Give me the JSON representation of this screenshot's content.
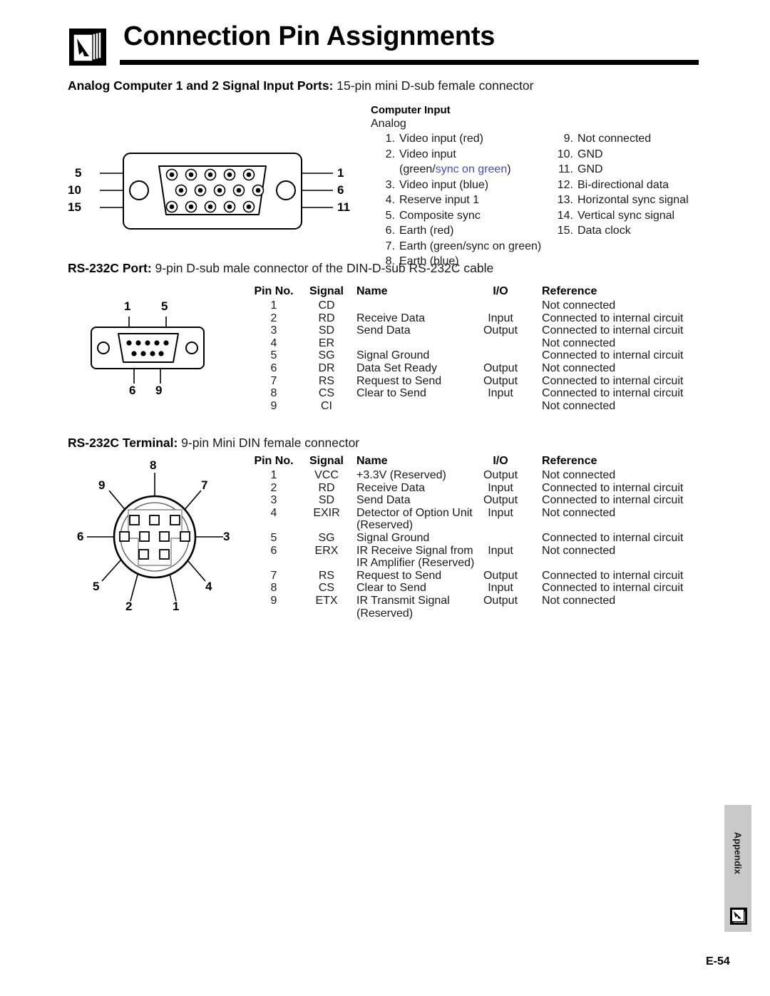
{
  "document": {
    "title": "Connection Pin Assignments",
    "page_number": "E-54",
    "tab_label": "Appendix"
  },
  "sections": {
    "analog": {
      "heading_bold": "Analog Computer 1 and 2 Signal Input Ports:",
      "heading_rest": " 15-pin mini D-sub female connector",
      "computer_input_title": "Computer Input",
      "analog_label": "Analog",
      "left_items": [
        {
          "num": "1.",
          "text": "Video input (red)"
        },
        {
          "num": "2.",
          "text": "Video input"
        },
        {
          "num": "3.",
          "text": "Video input (blue)"
        },
        {
          "num": "4.",
          "text": "Reserve input 1"
        },
        {
          "num": "5.",
          "text": "Composite sync"
        },
        {
          "num": "6.",
          "text": "Earth (red)"
        },
        {
          "num": "7.",
          "text": "Earth (green/sync on green)"
        },
        {
          "num": "8.",
          "text": "Earth (blue)"
        }
      ],
      "item2_sub_pre": "(green/",
      "item2_sub_blue": "sync on green",
      "item2_sub_post": ")",
      "right_items": [
        {
          "num": "9.",
          "text": "Not connected"
        },
        {
          "num": "10.",
          "text": "GND"
        },
        {
          "num": "11.",
          "text": "GND"
        },
        {
          "num": "12.",
          "text": "Bi-directional data"
        },
        {
          "num": "13.",
          "text": "Horizontal sync signal"
        },
        {
          "num": "14.",
          "text": "Vertical sync signal"
        },
        {
          "num": "15.",
          "text": "Data clock"
        }
      ],
      "diagram_labels": {
        "left": [
          "5",
          "10",
          "15"
        ],
        "right": [
          "1",
          "6",
          "11"
        ]
      }
    },
    "rs232c_port": {
      "heading_bold": "RS-232C Port:",
      "heading_rest": " 9-pin D-sub male connector of the DIN-D-sub RS-232C cable",
      "diagram_labels": {
        "top": [
          "1",
          "5"
        ],
        "bottom": [
          "6",
          "9"
        ]
      },
      "columns": [
        "Pin No.",
        "Signal",
        "Name",
        "I/O",
        "Reference"
      ],
      "rows": [
        {
          "pin": "1",
          "signal": "CD",
          "name": "",
          "io": "",
          "ref": "Not connected"
        },
        {
          "pin": "2",
          "signal": "RD",
          "name": "Receive Data",
          "io": "Input",
          "ref": "Connected to internal circuit"
        },
        {
          "pin": "3",
          "signal": "SD",
          "name": "Send Data",
          "io": "Output",
          "ref": "Connected to internal circuit"
        },
        {
          "pin": "4",
          "signal": "ER",
          "name": "",
          "io": "",
          "ref": "Not connected"
        },
        {
          "pin": "5",
          "signal": "SG",
          "name": "Signal Ground",
          "io": "",
          "ref": "Connected to internal circuit"
        },
        {
          "pin": "6",
          "signal": "DR",
          "name": "Data Set Ready",
          "io": "Output",
          "ref": "Not connected"
        },
        {
          "pin": "7",
          "signal": "RS",
          "name": "Request to Send",
          "io": "Output",
          "ref": "Connected to internal circuit"
        },
        {
          "pin": "8",
          "signal": "CS",
          "name": "Clear to Send",
          "io": "Input",
          "ref": "Connected to internal circuit"
        },
        {
          "pin": "9",
          "signal": "CI",
          "name": "",
          "io": "",
          "ref": "Not connected"
        }
      ]
    },
    "rs232c_terminal": {
      "heading_bold": "RS-232C Terminal:",
      "heading_rest": " 9-pin Mini DIN female connector",
      "diagram_labels": {
        "p1": "1",
        "p2": "2",
        "p3": "3",
        "p4": "4",
        "p5": "5",
        "p6": "6",
        "p7": "7",
        "p8": "8",
        "p9": "9"
      },
      "columns": [
        "Pin No.",
        "Signal",
        "Name",
        "I/O",
        "Reference"
      ],
      "rows": [
        {
          "pin": "1",
          "signal": "VCC",
          "name": "+3.3V (Reserved)",
          "name2": "",
          "io": "Output",
          "ref": "Not connected"
        },
        {
          "pin": "2",
          "signal": "RD",
          "name": "Receive Data",
          "name2": "",
          "io": "Input",
          "ref": "Connected to internal circuit"
        },
        {
          "pin": "3",
          "signal": "SD",
          "name": "Send Data",
          "name2": "",
          "io": "Output",
          "ref": "Connected to internal circuit"
        },
        {
          "pin": "4",
          "signal": "EXIR",
          "name": "Detector of Option Unit",
          "name2": "(Reserved)",
          "io": "Input",
          "ref": "Not connected"
        },
        {
          "pin": "5",
          "signal": "SG",
          "name": "Signal Ground",
          "name2": "",
          "io": "",
          "ref": "Connected to internal circuit"
        },
        {
          "pin": "6",
          "signal": "ERX",
          "name": "IR Receive Signal from",
          "name2": "IR Amplifier (Reserved)",
          "io": "Input",
          "ref": "Not connected"
        },
        {
          "pin": "7",
          "signal": "RS",
          "name": "Request to Send",
          "name2": "",
          "io": "Output",
          "ref": "Connected to internal circuit"
        },
        {
          "pin": "8",
          "signal": "CS",
          "name": "Clear to Send",
          "name2": "",
          "io": "Input",
          "ref": "Connected to internal circuit"
        },
        {
          "pin": "9",
          "signal": "ETX",
          "name": "IR Transmit Signal",
          "name2": "(Reserved)",
          "io": "Output",
          "ref": "Not connected"
        }
      ]
    }
  },
  "colors": {
    "blue_text": "#3b4ecc",
    "rule": "#000000",
    "tab_bg": "#c9c9c9"
  }
}
